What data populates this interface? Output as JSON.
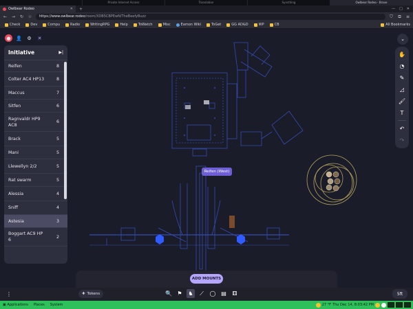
{
  "os_tabs": [
    "",
    "Private Internet Access",
    "Translation",
    "Syncthing",
    "Owlbear Rodeo - Brave"
  ],
  "browser": {
    "tab_title": "Owlbear Rodeo",
    "url_host": "https://www.owlbear.rodeo",
    "url_path": "/room/XDB5CBPEwN/TheBeefyBuzz",
    "bookmarks": [
      "Check",
      "Dev",
      "Compu",
      "Radio",
      "WritingRPG",
      "Help",
      "ToWatch",
      "Misc",
      "Eamon Wiki",
      "ToGet",
      "GG AD&D",
      "WP",
      "CB"
    ],
    "all_bookmarks": "All Bookmarks"
  },
  "initiative": {
    "title": "Initiative",
    "items": [
      {
        "name": "Reifen",
        "value": "8",
        "active": false
      },
      {
        "name": "Colter AC4 HP13",
        "value": "8",
        "active": false
      },
      {
        "name": "Maccus",
        "value": "7",
        "active": false
      },
      {
        "name": "Sitfen",
        "value": "6",
        "active": false
      },
      {
        "name": "Ragnvaldr HP9 AC8",
        "value": "6",
        "active": false
      },
      {
        "name": "Brack",
        "value": "5",
        "active": false
      },
      {
        "name": "Mani",
        "value": "5",
        "active": false
      },
      {
        "name": "Llewellyn 2/2",
        "value": "5",
        "active": false
      },
      {
        "name": "Rat swarm",
        "value": "5",
        "active": false
      },
      {
        "name": "Alessia",
        "value": "4",
        "active": false
      },
      {
        "name": "Sniff",
        "value": "4",
        "active": false
      },
      {
        "name": "Astesia",
        "value": "3",
        "active": true
      },
      {
        "name": "Boggart AC9 HP 6",
        "value": "2",
        "active": false
      }
    ]
  },
  "map": {
    "tooltip": "Reifen (West)",
    "accent": "#3a54c9",
    "token_color": "#2f5bff"
  },
  "bottom": {
    "add_mounts": "ADD MOUNTS",
    "tokens": "Tokens",
    "scale": "5ft"
  },
  "taskbar": {
    "items": [
      "Applications",
      "Places",
      "System"
    ],
    "temp": "27 °F",
    "clock": "Thu Dec 14, 8:03:42 PM"
  },
  "icons": {
    "right_tools": [
      "move-icon",
      "fog-icon",
      "draw-icon",
      "measure-icon",
      "brush-icon",
      "text-icon",
      "undo-icon",
      "redo-icon"
    ],
    "bottom_tools": [
      "search-icon",
      "pin-icon",
      "horse-icon",
      "ruler-icon",
      "circle-icon",
      "note-icon",
      "dice-icon"
    ]
  }
}
